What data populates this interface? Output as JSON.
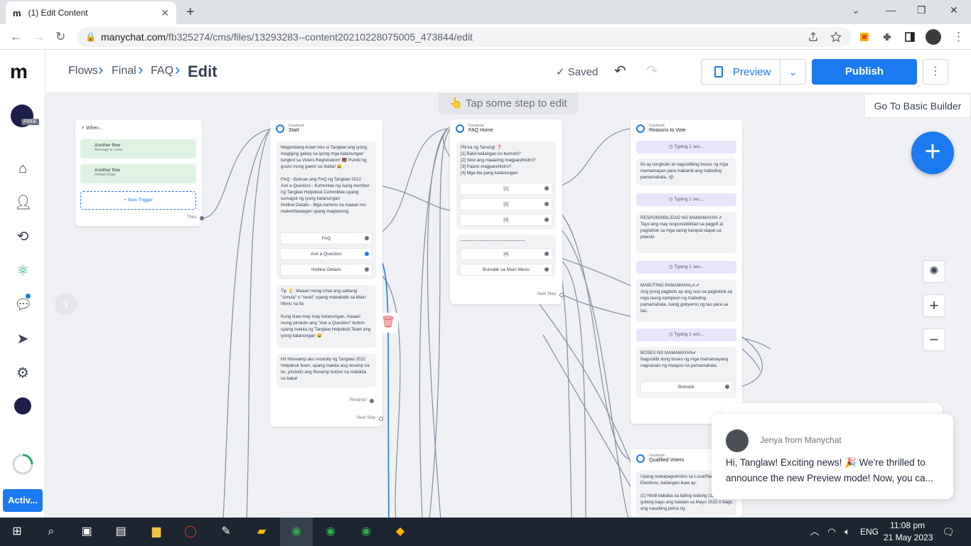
{
  "browser": {
    "tab_title": "(1) Edit Content",
    "tab_favicon": "m",
    "url_host": "manychat.com",
    "url_path": "/fb325274/cms/files/13293283--content20210228075005_473844/edit"
  },
  "topbar": {
    "crumbs": [
      "Flows",
      "Final",
      "FAQ"
    ],
    "current": "Edit",
    "saved_label": "Saved",
    "preview_label": "Preview",
    "publish_label": "Publish",
    "basic_builder_label": "Go To Basic Builder"
  },
  "canvas": {
    "hint": "Tap some step to edit",
    "activ_label": "Activ..."
  },
  "trigger_card": {
    "title": "When...",
    "triggers": [
      {
        "name": "Another flow",
        "sub": "Message is Luma"
      },
      {
        "name": "Another flow",
        "sub": "Default Reply"
      }
    ],
    "new_trigger": "+ New Trigger",
    "then": "Then"
  },
  "start_card": {
    "source": "Facebook",
    "title": "Start",
    "msg1": "Magandang Araw! Ako si Tanglaw ang iyong magiging gabay sa iyong mga katanungan tungkol sa Voters Registration! 🐻 Pumili ng gusto mong gawin sa ibaba! 😀\n\nFAQ - Buksan ang FAQ ng Tanglaw 2022\nAsk a Question - Kumontak ng isang member ng Tanglaw Helpdesk Committee upang sumagot ng iyong katanungan\nHotline Details - Mga numero na maaari mo matext/tawagan upang magtanong",
    "buttons": [
      "FAQ",
      "Ask a Question",
      "Hotline Details"
    ],
    "msg2": "Tip 💡: Maaari mong ichat ang salitang \"simula\" o \"reset\" upang makabalik sa Main Menu na ito\n\nKung ikaw may may katanungan, maaari mong pindutin ang \"Ask a Question\" button upang makita ng Tanglaw Helpdesk Team ang iyong katanungan 😀",
    "msg3": "Hi! Nirevamp ako recently ng Tanglaw 2022 Helpdesk team, upang makita ang revamp na ito, pindutin ang Revamp button na makikita sa baba!",
    "revamp": "Revamp!",
    "next_step": "Next Step"
  },
  "faq_card": {
    "source": "Facebook",
    "title": "FAQ Home",
    "msg": "Pili ka ng Tanong! ❓\n[1] Bakit kailangan ko bumoto?\n[2] Sino ang maaaring magparehistro?\n[3] Paano magparehistro?\n[4] Mga iba pang katanungan",
    "buttons": [
      "[1]",
      "[2]",
      "[3]"
    ],
    "divider": "--------------------------------------------",
    "buttons2": [
      "[4]",
      "Bumalik sa Main Menu"
    ],
    "next_step": "Next Step"
  },
  "reasons_card": {
    "source": "Facebook",
    "title": "Reasons to Vote",
    "typing": "Typing 1 sec...",
    "msg1": "Ito ay tungkulin at nagsisilbing boses ng mga mamamayan para makamit ang mabuting pamamahala. 🗳",
    "msg2": "RESPONSIBILIDAD NG MAMAMAYAN ✔\nTayo ang may responsibilidad sa pagpili at pagluklok sa mga taong karapat-dapat sa pwesto",
    "msg3": "MABUTING PAMAMAHALA ✔\nAng iyong pagboto ay ang susi sa pagluklok sa mga taong kampeon ng mabuting pamamahala. Isang gobyerno ng tao para sa tao.",
    "msg4": "BOSES NG MAMAMAYAN✔\nNagsisilbi itong boses ng mga mamamayang nagnanais ng maayos na pamamahala.",
    "back": "Bumalik"
  },
  "qualified_card": {
    "source": "Facebook",
    "title": "Qualified Voters",
    "msg": "Upang makapagrehistro sa Local/National Elections, kailangan ikaw ay:\n\n(1) Hindi bababa sa labing walong (18) taong gulang bago ang halalan sa Mayo 2022 o bago ang nasabing petsa ng"
  },
  "chat": {
    "from": "Jenya from Manychat",
    "text": "Hi, Tanglaw! Exciting news! 🎉 We're thrilled to announce the new Preview mode! Now, you ca..."
  },
  "taskbar": {
    "lang": "ENG",
    "time": "11:08 pm",
    "date": "21 May 2023"
  },
  "colors": {
    "accent": "#1b7af0",
    "trigger_bg": "#dff3e4",
    "typing_bg": "#e9e5fb"
  }
}
